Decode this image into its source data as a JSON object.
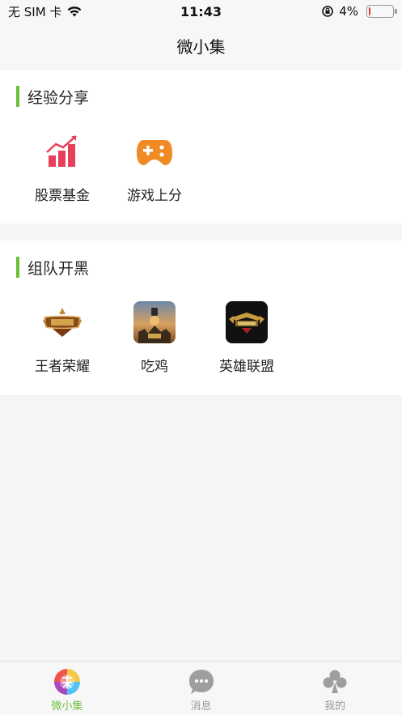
{
  "status_bar": {
    "carrier": "无 SIM 卡",
    "time": "11:43",
    "battery": "4%",
    "battery_level": 0.04
  },
  "nav": {
    "title": "微小集"
  },
  "sections": [
    {
      "title": "经验分享",
      "items": [
        {
          "label": "股票基金",
          "icon": "stock-chart-icon"
        },
        {
          "label": "游戏上分",
          "icon": "gamepad-icon"
        }
      ]
    },
    {
      "title": "组队开黑",
      "items": [
        {
          "label": "王者荣耀",
          "icon": "honor-of-kings-logo"
        },
        {
          "label": "吃鸡",
          "icon": "pubg-thumbnail"
        },
        {
          "label": "英雄联盟",
          "icon": "league-of-legends-logo"
        }
      ]
    }
  ],
  "tabs": [
    {
      "label": "微小集",
      "icon": "app-logo-icon",
      "active": true
    },
    {
      "label": "消息",
      "icon": "message-icon",
      "active": false
    },
    {
      "label": "我的",
      "icon": "profile-icon",
      "active": false
    }
  ],
  "colors": {
    "accent": "#6cbf3a",
    "stock_icon": "#e8405a",
    "game_icon": "#f08a24",
    "battery_low": "#e53935"
  }
}
